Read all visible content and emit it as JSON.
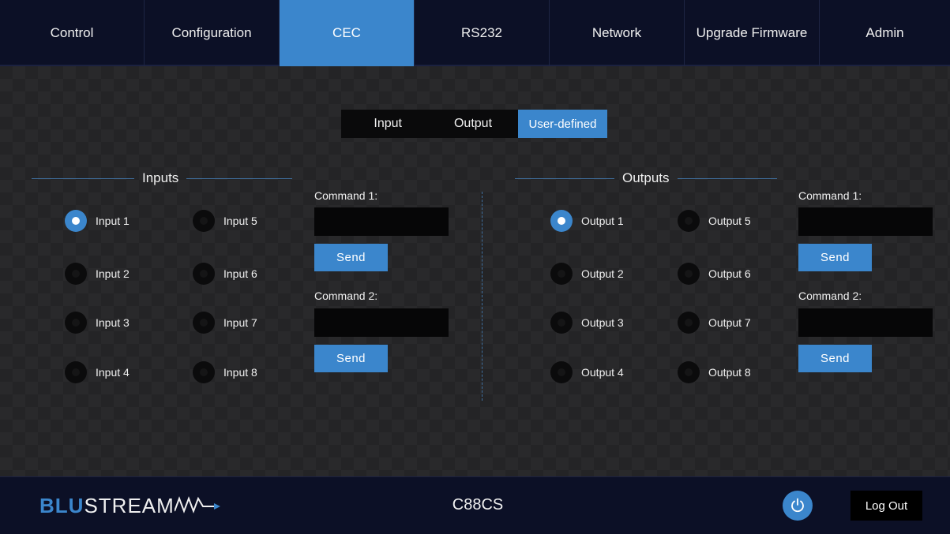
{
  "nav": {
    "items": [
      {
        "label": "Control"
      },
      {
        "label": "Configuration"
      },
      {
        "label": "CEC"
      },
      {
        "label": "RS232"
      },
      {
        "label": "Network"
      },
      {
        "label": "Upgrade Firmware"
      },
      {
        "label": "Admin"
      }
    ],
    "active": "CEC"
  },
  "subtabs": {
    "items": [
      {
        "label": "Input"
      },
      {
        "label": "Output"
      },
      {
        "label": "User-defined"
      }
    ],
    "active": "User-defined"
  },
  "inputs": {
    "title": "Inputs",
    "selected": "Input 1",
    "items": [
      {
        "label": "Input 1"
      },
      {
        "label": "Input 2"
      },
      {
        "label": "Input 3"
      },
      {
        "label": "Input 4"
      },
      {
        "label": "Input 5"
      },
      {
        "label": "Input 6"
      },
      {
        "label": "Input 7"
      },
      {
        "label": "Input 8"
      }
    ],
    "command1_label": "Command 1:",
    "command1_value": "",
    "command2_label": "Command 2:",
    "command2_value": "",
    "send_label": "Send"
  },
  "outputs": {
    "title": "Outputs",
    "selected": "Output 1",
    "items": [
      {
        "label": "Output 1"
      },
      {
        "label": "Output 2"
      },
      {
        "label": "Output 3"
      },
      {
        "label": "Output 4"
      },
      {
        "label": "Output 5"
      },
      {
        "label": "Output 6"
      },
      {
        "label": "Output 7"
      },
      {
        "label": "Output 8"
      }
    ],
    "command1_label": "Command 1:",
    "command1_value": "",
    "command2_label": "Command 2:",
    "command2_value": "",
    "send_label": "Send"
  },
  "footer": {
    "logo_blu": "BLU",
    "logo_stream": "STREAM",
    "model": "C88CS",
    "logout_label": "Log Out",
    "power_icon": "power-icon"
  },
  "colors": {
    "accent": "#3b86cc",
    "nav_bg": "#0c1026",
    "panel_bg": "#242426"
  }
}
